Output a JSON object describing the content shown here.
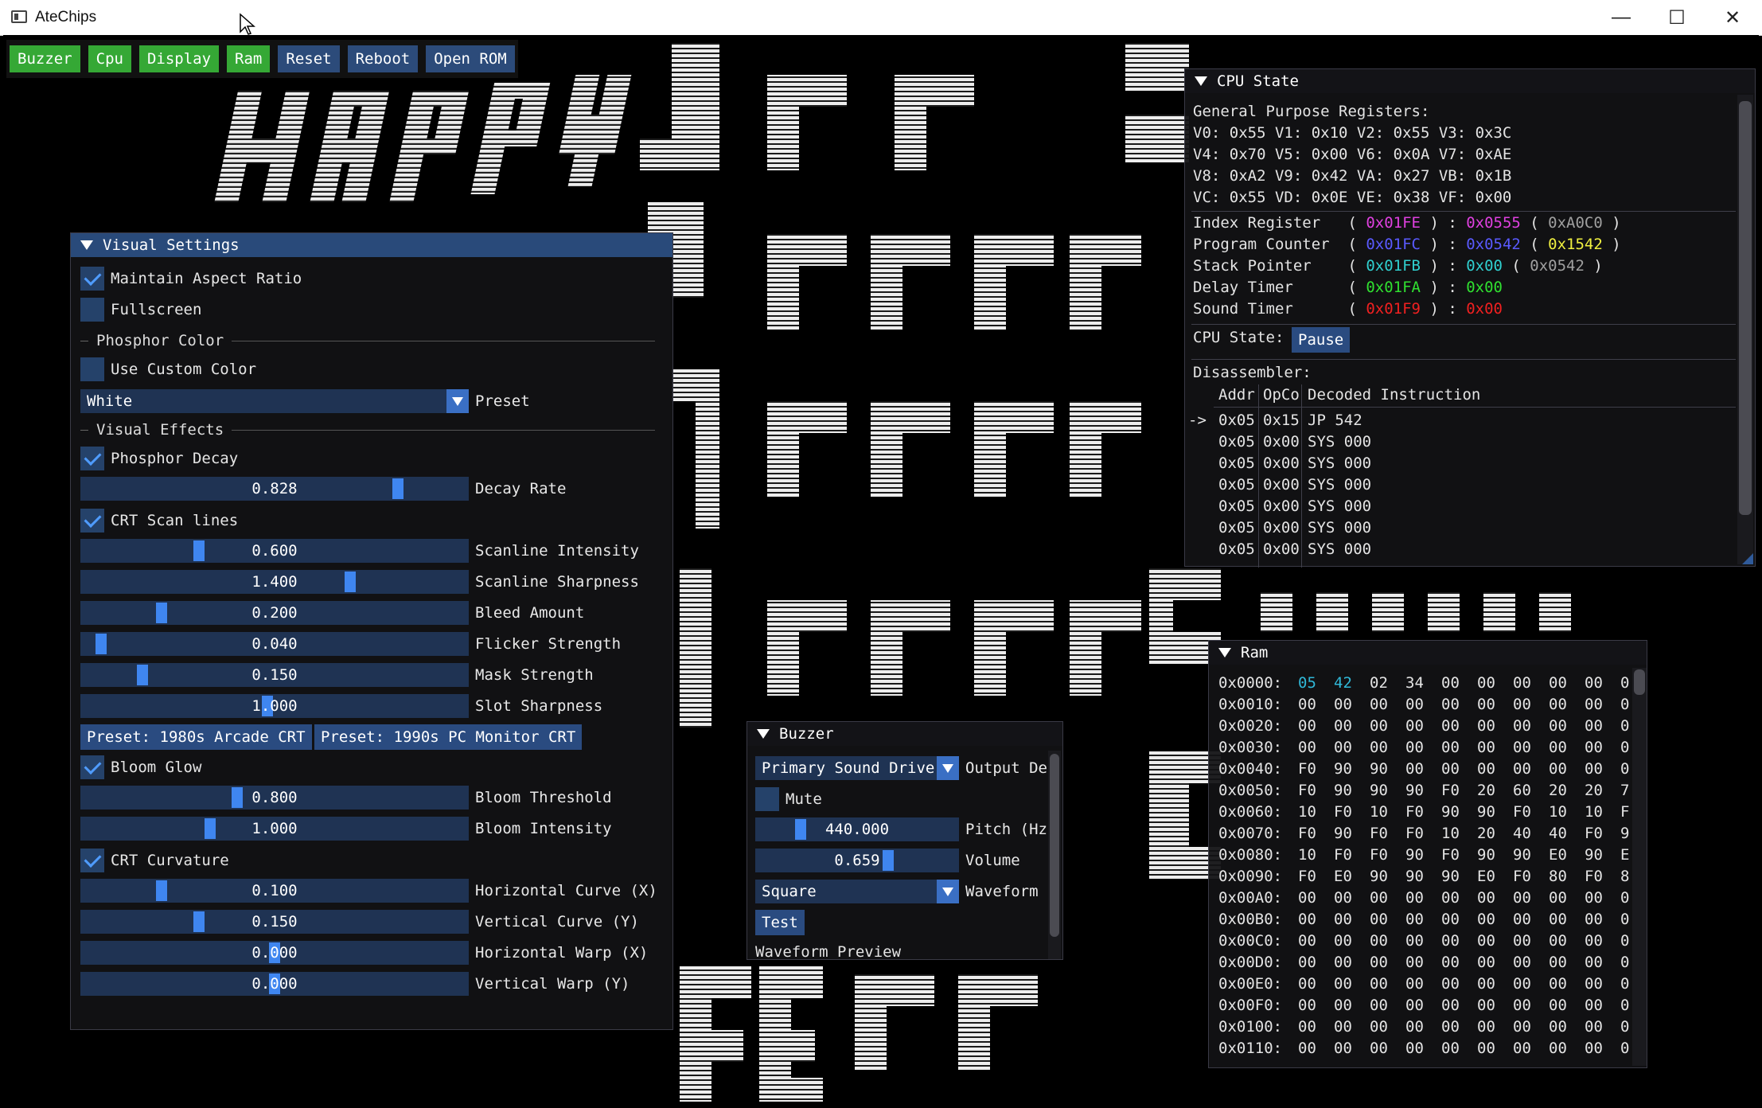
{
  "window": {
    "title": "AteChips",
    "minimize_glyph": "—",
    "maximize_glyph": "☐",
    "close_glyph": "✕"
  },
  "menu": [
    {
      "label": "Buzzer",
      "active": true
    },
    {
      "label": "Cpu",
      "active": true
    },
    {
      "label": "Display",
      "active": true
    },
    {
      "label": "Ram",
      "active": true
    },
    {
      "label": "Reset",
      "active": false
    },
    {
      "label": "Reboot",
      "active": false
    },
    {
      "label": "Open ROM",
      "active": false
    }
  ],
  "visual": {
    "title": "Visual Settings",
    "maintain_aspect": "Maintain Aspect Ratio",
    "fullscreen": "Fullscreen",
    "phosphor_color": "Phosphor Color",
    "use_custom": "Use Custom Color",
    "preset_value": "White",
    "preset_label": "Preset",
    "visual_effects": "Visual Effects",
    "phosphor_decay": "Phosphor Decay",
    "crt_scan": "CRT Scan lines",
    "preset1": "Preset: 1980s Arcade CRT",
    "preset2": "Preset: 1990s PC Monitor CRT",
    "bloom": "Bloom Glow",
    "curvature": "CRT Curvature",
    "sliders": [
      {
        "value": "0.828",
        "label": "Decay Rate",
        "frac": 0.828
      },
      {
        "value": "0.600",
        "label": "Scanline Intensity",
        "frac": 0.3
      },
      {
        "value": "1.400",
        "label": "Scanline Sharpness",
        "frac": 0.7
      },
      {
        "value": "0.200",
        "label": "Bleed Amount",
        "frac": 0.2
      },
      {
        "value": "0.040",
        "label": "Flicker Strength",
        "frac": 0.04
      },
      {
        "value": "0.150",
        "label": "Mask Strength",
        "frac": 0.15
      },
      {
        "value": "1.000",
        "label": "Slot Sharpness",
        "frac": 0.48
      },
      {
        "value": "0.800",
        "label": "Bloom Threshold",
        "frac": 0.4
      },
      {
        "value": "1.000",
        "label": "Bloom Intensity",
        "frac": 0.33
      },
      {
        "value": "0.100",
        "label": "Horizontal Curve (X)",
        "frac": 0.2
      },
      {
        "value": "0.150",
        "label": "Vertical Curve (Y)",
        "frac": 0.3
      },
      {
        "value": "0.000",
        "label": "Horizontal Warp (X)",
        "frac": 0.5
      },
      {
        "value": "0.000",
        "label": "Vertical Warp (Y)",
        "frac": 0.5
      }
    ]
  },
  "cpu": {
    "title": "CPU State",
    "gpr_label": "General Purpose Registers:",
    "gpr": [
      "V0: 0x55 V1: 0x10 V2: 0x55 V3: 0x3C",
      "V4: 0x70 V5: 0x00 V6: 0x0A V7: 0xAE",
      "V8: 0xA2 V9: 0x42 VA: 0x27 VB: 0x1B",
      "VC: 0x55 VD: 0x0E VE: 0x38 VF: 0x00"
    ],
    "regs": [
      {
        "name": "Index Register  ",
        "addr": "0x01FE",
        "val": "0x0555",
        "extra": "0xA0C0",
        "ac": "c-mag",
        "vc": "c-mag",
        "ec": "c-mag dim2"
      },
      {
        "name": "Program Counter ",
        "addr": "0x01FC",
        "val": "0x0542",
        "extra": "0x1542",
        "ac": "c-blu",
        "vc": "c-blu",
        "ec": "c-yel"
      },
      {
        "name": "Stack Pointer   ",
        "addr": "0x01FB",
        "val": "0x00",
        "extra": "0x0542",
        "ac": "c-cyn",
        "vc": "c-cyn",
        "ec": "c-cyn dim2"
      },
      {
        "name": "Delay Timer     ",
        "addr": "0x01FA",
        "val": "0x00",
        "extra": "",
        "ac": "c-grn",
        "vc": "c-grn",
        "ec": ""
      },
      {
        "name": "Sound Timer     ",
        "addr": "0x01F9",
        "val": "0x00",
        "extra": "",
        "ac": "c-red",
        "vc": "c-red",
        "ec": ""
      }
    ],
    "state_label": "CPU State:",
    "pause": "Pause",
    "disasm_label": "Disassembler:",
    "cols": [
      "Addr",
      "OpCo",
      "Decoded Instruction"
    ],
    "disasm": [
      {
        "mark": "->",
        "addr": "0x05",
        "op": "0x15",
        "ins": "JP 542"
      },
      {
        "mark": "",
        "addr": "0x05",
        "op": "0x00",
        "ins": "SYS 000"
      },
      {
        "mark": "",
        "addr": "0x05",
        "op": "0x00",
        "ins": "SYS 000"
      },
      {
        "mark": "",
        "addr": "0x05",
        "op": "0x00",
        "ins": "SYS 000"
      },
      {
        "mark": "",
        "addr": "0x05",
        "op": "0x00",
        "ins": "SYS 000"
      },
      {
        "mark": "",
        "addr": "0x05",
        "op": "0x00",
        "ins": "SYS 000"
      },
      {
        "mark": "",
        "addr": "0x05",
        "op": "0x00",
        "ins": "SYS 000"
      }
    ]
  },
  "buzzer": {
    "title": "Buzzer",
    "driver": "Primary Sound Driver",
    "driver_label": "Output De",
    "mute": "Mute",
    "pitch": "440.000",
    "pitch_label": "Pitch (Hz",
    "volume": "0.659",
    "volume_label": "Volume",
    "waveform": "Square",
    "waveform_label": "Waveform",
    "test": "Test",
    "preview": "Waveform Preview"
  },
  "ram": {
    "title": "Ram",
    "rows": [
      {
        "addr": "0x0000:",
        "bytes": [
          "05",
          "42",
          "02",
          "34",
          "00",
          "00",
          "00",
          "00",
          "00",
          "0"
        ]
      },
      {
        "addr": "0x0010:",
        "bytes": [
          "00",
          "00",
          "00",
          "00",
          "00",
          "00",
          "00",
          "00",
          "00",
          "0"
        ]
      },
      {
        "addr": "0x0020:",
        "bytes": [
          "00",
          "00",
          "00",
          "00",
          "00",
          "00",
          "00",
          "00",
          "00",
          "0"
        ]
      },
      {
        "addr": "0x0030:",
        "bytes": [
          "00",
          "00",
          "00",
          "00",
          "00",
          "00",
          "00",
          "00",
          "00",
          "0"
        ]
      },
      {
        "addr": "0x0040:",
        "bytes": [
          "F0",
          "90",
          "90",
          "00",
          "00",
          "00",
          "00",
          "00",
          "00",
          "0"
        ]
      },
      {
        "addr": "0x0050:",
        "bytes": [
          "F0",
          "90",
          "90",
          "90",
          "F0",
          "20",
          "60",
          "20",
          "20",
          "7"
        ]
      },
      {
        "addr": "0x0060:",
        "bytes": [
          "10",
          "F0",
          "10",
          "F0",
          "90",
          "90",
          "F0",
          "10",
          "10",
          "F"
        ]
      },
      {
        "addr": "0x0070:",
        "bytes": [
          "F0",
          "90",
          "F0",
          "F0",
          "10",
          "20",
          "40",
          "40",
          "F0",
          "9"
        ]
      },
      {
        "addr": "0x0080:",
        "bytes": [
          "10",
          "F0",
          "F0",
          "90",
          "F0",
          "90",
          "90",
          "E0",
          "90",
          "E"
        ]
      },
      {
        "addr": "0x0090:",
        "bytes": [
          "F0",
          "E0",
          "90",
          "90",
          "90",
          "E0",
          "F0",
          "80",
          "F0",
          "8"
        ]
      },
      {
        "addr": "0x00A0:",
        "bytes": [
          "00",
          "00",
          "00",
          "00",
          "00",
          "00",
          "00",
          "00",
          "00",
          "0"
        ]
      },
      {
        "addr": "0x00B0:",
        "bytes": [
          "00",
          "00",
          "00",
          "00",
          "00",
          "00",
          "00",
          "00",
          "00",
          "0"
        ]
      },
      {
        "addr": "0x00C0:",
        "bytes": [
          "00",
          "00",
          "00",
          "00",
          "00",
          "00",
          "00",
          "00",
          "00",
          "0"
        ]
      },
      {
        "addr": "0x00D0:",
        "bytes": [
          "00",
          "00",
          "00",
          "00",
          "00",
          "00",
          "00",
          "00",
          "00",
          "0"
        ]
      },
      {
        "addr": "0x00E0:",
        "bytes": [
          "00",
          "00",
          "00",
          "00",
          "00",
          "00",
          "00",
          "00",
          "00",
          "0"
        ]
      },
      {
        "addr": "0x00F0:",
        "bytes": [
          "00",
          "00",
          "00",
          "00",
          "00",
          "00",
          "00",
          "00",
          "00",
          "0"
        ]
      },
      {
        "addr": "0x0100:",
        "bytes": [
          "00",
          "00",
          "00",
          "00",
          "00",
          "00",
          "00",
          "00",
          "00",
          "0"
        ]
      },
      {
        "addr": "0x0110:",
        "bytes": [
          "00",
          "00",
          "00",
          "00",
          "00",
          "00",
          "00",
          "00",
          "00",
          "0"
        ]
      }
    ],
    "highlight_color": "#30b8d8"
  },
  "colors": {
    "accent": "#294a7a",
    "green": "#35a835",
    "slider": "#1f3353",
    "grab": "#3f86f0"
  }
}
